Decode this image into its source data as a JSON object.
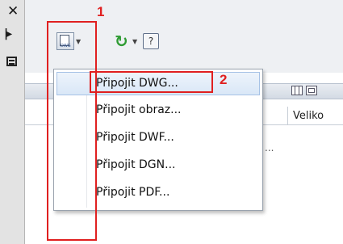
{
  "left_strip": {
    "icons": [
      "close-icon",
      "pin-icon",
      "properties-icon"
    ]
  },
  "toolbar": {
    "attach_button_icon": "attach-dwg-icon",
    "refresh_button_icon": "refresh-icon",
    "help_button_icon": "help-icon",
    "help_glyph": "?"
  },
  "annotations": {
    "label_1": "1",
    "label_2": "2",
    "color": "#e02020"
  },
  "panel": {
    "column_label": "Veliko",
    "ellipsis": "..."
  },
  "menu": {
    "items": [
      {
        "label": "Připojit DWG..."
      },
      {
        "label": "Připojit obraz..."
      },
      {
        "label": "Připojit DWF..."
      },
      {
        "label": "Připojit DGN..."
      },
      {
        "label": "Připojit PDF..."
      }
    ],
    "highlighted_index": 0,
    "highlight_color": "#d9e7f7"
  }
}
